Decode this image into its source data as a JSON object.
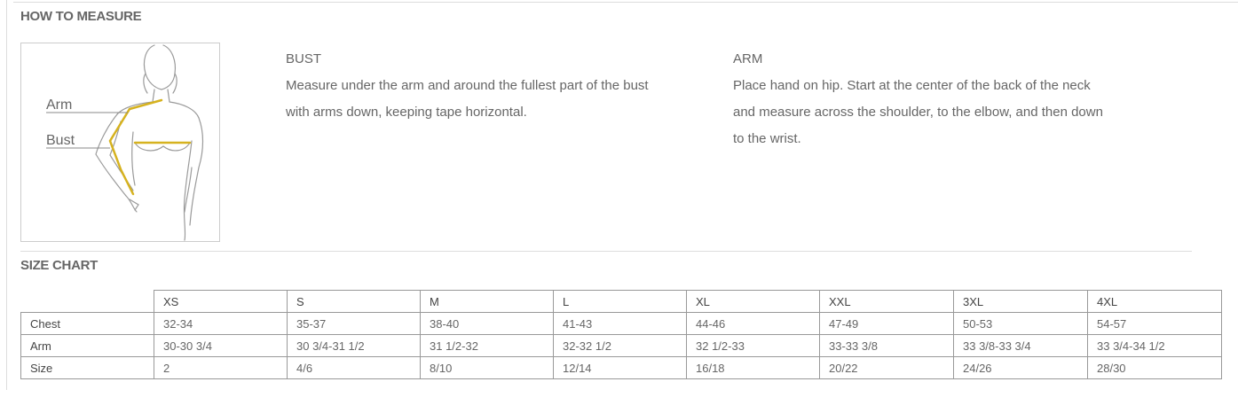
{
  "how_to_measure": {
    "title": "HOW TO MEASURE",
    "figure": {
      "arm_label": "Arm",
      "bust_label": "Bust",
      "tape_color": "#d6b21f"
    },
    "bust": {
      "heading": "BUST",
      "line1": "Measure under the arm and around the fullest part of the bust",
      "line2": "with arms down, keeping tape horizontal."
    },
    "arm": {
      "heading": "ARM",
      "line1": "Place hand on hip. Start at the center of the back of the neck",
      "line2": "and measure across the shoulder, to the elbow, and then down",
      "line3": "to the wrist."
    }
  },
  "size_chart": {
    "title": "SIZE CHART",
    "columns": [
      "XS",
      "S",
      "M",
      "L",
      "XL",
      "XXL",
      "3XL",
      "4XL"
    ],
    "rows": [
      {
        "label": "Chest",
        "values": [
          "32-34",
          "35-37",
          "38-40",
          "41-43",
          "44-46",
          "47-49",
          "50-53",
          "54-57"
        ]
      },
      {
        "label": "Arm",
        "values": [
          "30-30 3/4",
          "30 3/4-31 1/2",
          "31 1/2-32",
          "32-32 1/2",
          "32 1/2-33",
          "33-33 3/8",
          "33 3/8-33 3/4",
          "33 3/4-34 1/2"
        ]
      },
      {
        "label": "Size",
        "values": [
          "2",
          "4/6",
          "8/10",
          "12/14",
          "16/18",
          "20/22",
          "24/26",
          "28/30"
        ]
      }
    ]
  }
}
